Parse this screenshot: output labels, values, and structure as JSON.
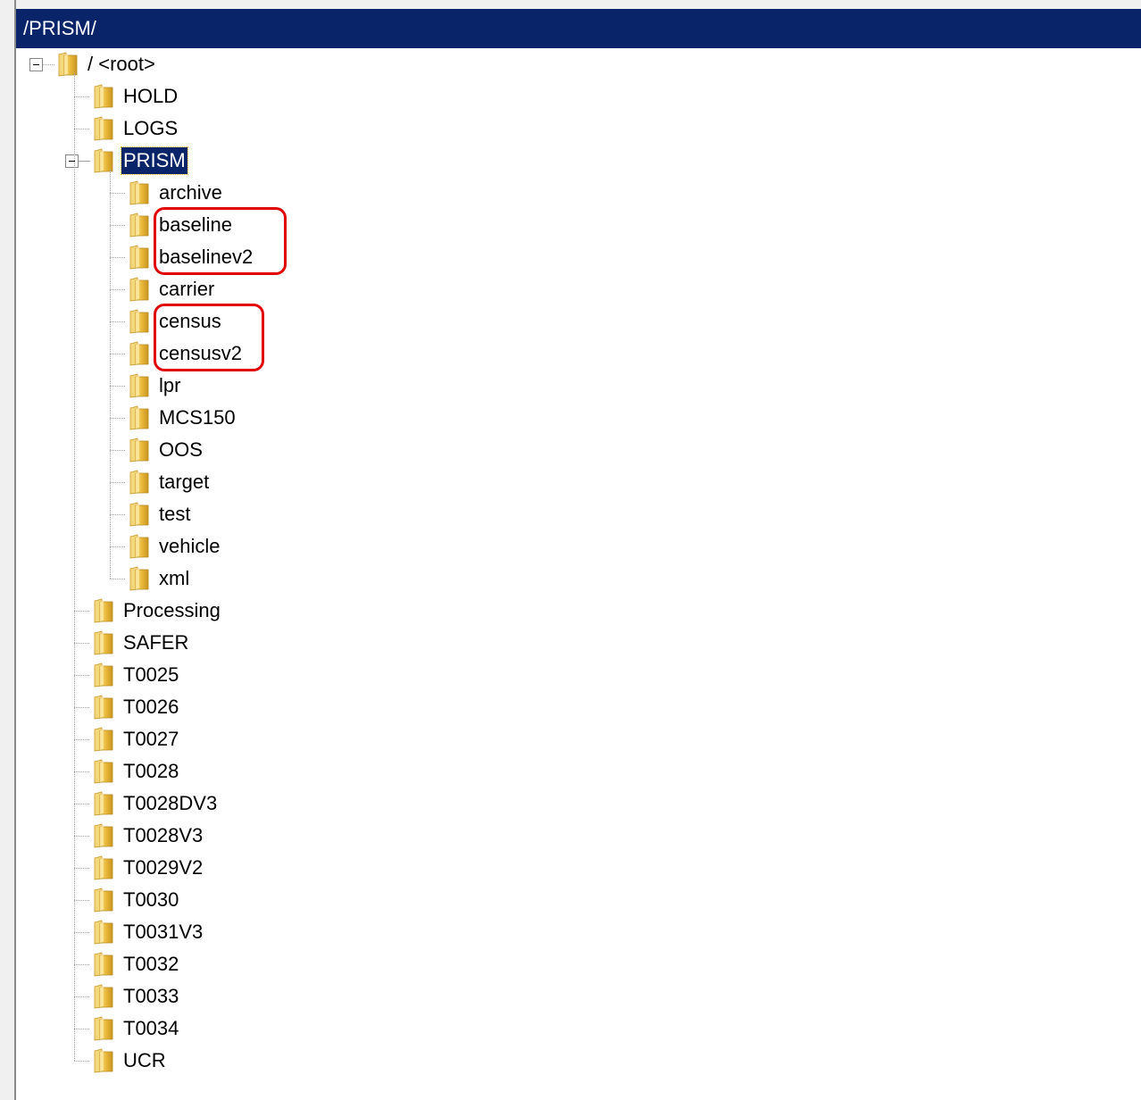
{
  "path_bar": {
    "text": "/PRISM/"
  },
  "tree": {
    "root": {
      "label": "/ <root>",
      "expanded": true
    },
    "level1": [
      {
        "label": "HOLD"
      },
      {
        "label": "LOGS"
      },
      {
        "label": "PRISM",
        "expanded": true,
        "selected": true
      },
      {
        "label": "Processing"
      },
      {
        "label": "SAFER"
      },
      {
        "label": "T0025"
      },
      {
        "label": "T0026"
      },
      {
        "label": "T0027"
      },
      {
        "label": "T0028"
      },
      {
        "label": "T0028DV3"
      },
      {
        "label": "T0028V3"
      },
      {
        "label": "T0029V2"
      },
      {
        "label": "T0030"
      },
      {
        "label": "T0031V3"
      },
      {
        "label": "T0032"
      },
      {
        "label": "T0033"
      },
      {
        "label": "T0034"
      },
      {
        "label": "UCR"
      }
    ],
    "prism_children": [
      {
        "label": "archive"
      },
      {
        "label": "baseline",
        "highlighted": true
      },
      {
        "label": "baselinev2",
        "highlighted": true
      },
      {
        "label": "carrier"
      },
      {
        "label": "census",
        "highlighted": true
      },
      {
        "label": "censusv2",
        "highlighted": true
      },
      {
        "label": "lpr"
      },
      {
        "label": "MCS150"
      },
      {
        "label": "OOS"
      },
      {
        "label": "target"
      },
      {
        "label": "test"
      },
      {
        "label": "vehicle"
      },
      {
        "label": "xml"
      }
    ]
  },
  "colors": {
    "title_bar": "#0a246a",
    "selection": "#0a246a",
    "annotation": "#e00000",
    "folder": "#e8b83a"
  },
  "icons": {
    "folder": "folder-icon",
    "collapse": "collapse-icon"
  }
}
